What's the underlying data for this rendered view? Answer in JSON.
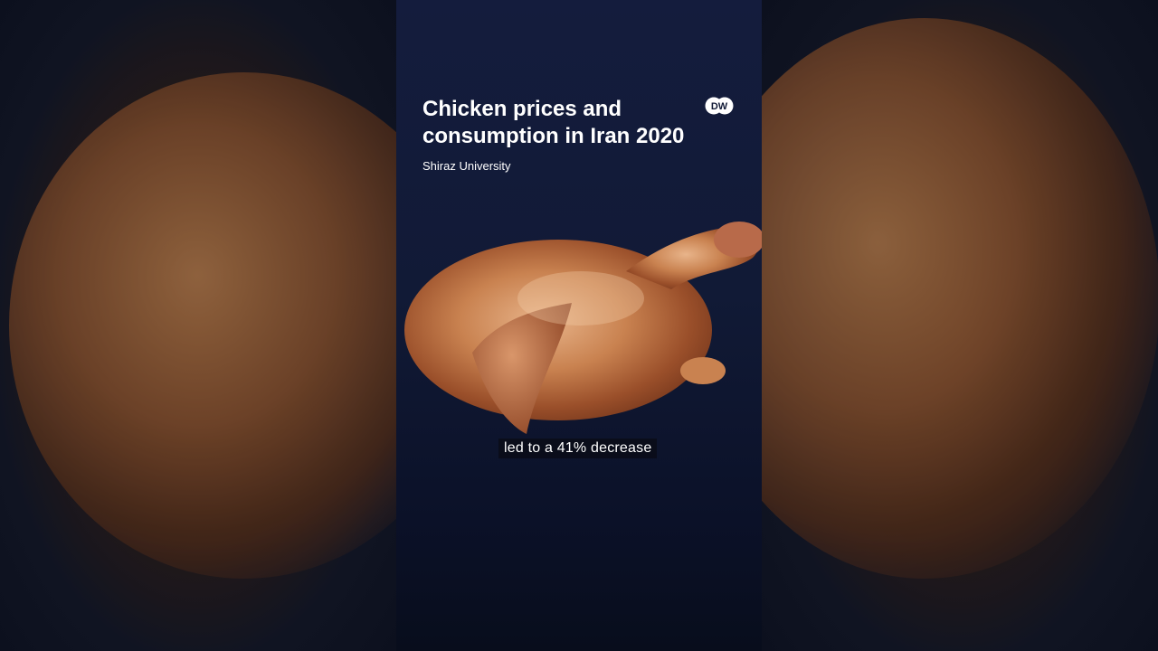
{
  "video": {
    "title": "Chicken prices and consumption in Iran 2020",
    "source": "Shiraz University",
    "caption": "led to a 41% decrease",
    "logo_text": "DW"
  },
  "colors": {
    "panel_top": "#141c3d",
    "panel_bottom": "#080d1c",
    "text": "#ffffff"
  }
}
